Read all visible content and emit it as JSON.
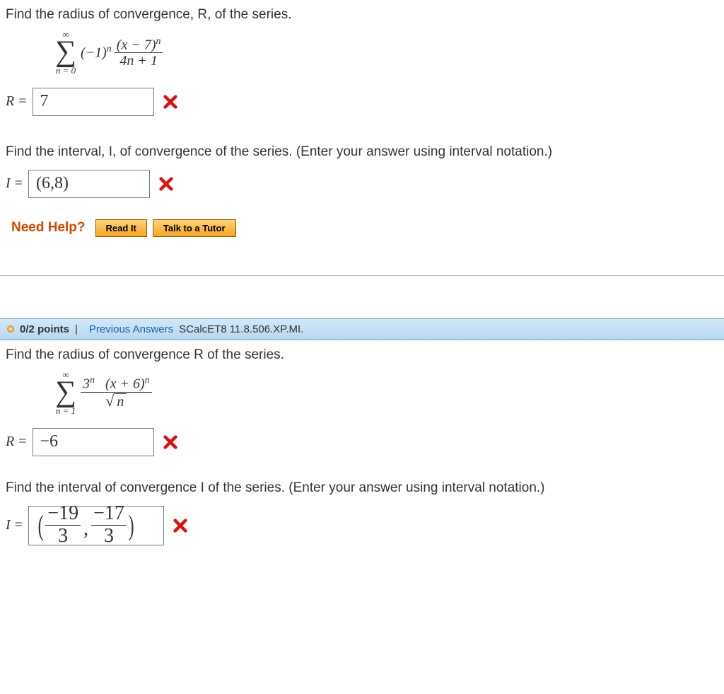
{
  "q1": {
    "prompt_radius": "Find the radius of convergence, R, of the series.",
    "series": {
      "top": "∞",
      "bottom": "n = 0",
      "coeff": "(−1)",
      "coeff_exp": "n",
      "num": "(x − 7)",
      "num_exp": "n",
      "den": "4n + 1"
    },
    "R_label": "R",
    "R_value": "7",
    "prompt_interval": "Find the interval, I, of convergence of the series. (Enter your answer using interval notation.)",
    "I_label": "I",
    "I_value": "(6,8)",
    "help_label": "Need Help?",
    "read_it": "Read It",
    "tutor": "Talk to a Tutor"
  },
  "header2": {
    "points": "0/2 points",
    "sep": "|",
    "prev": "Previous Answers",
    "src": "SCalcET8 11.8.506.XP.MI."
  },
  "q2": {
    "prompt_radius": "Find the radius of convergence R of the series.",
    "series": {
      "top": "∞",
      "bottom": "n = 1",
      "num_base": "3",
      "num_exp1": "n",
      "num_rest": "(x + 6)",
      "num_exp2": "n",
      "den_var": "n"
    },
    "R_label": "R",
    "R_value": "−6",
    "prompt_interval": "Find the interval of convergence I of the series. (Enter your answer using interval notation.)",
    "I_label": "I",
    "I_num1": "−19",
    "I_den1": "3",
    "I_num2": "−17",
    "I_den2": "3"
  }
}
